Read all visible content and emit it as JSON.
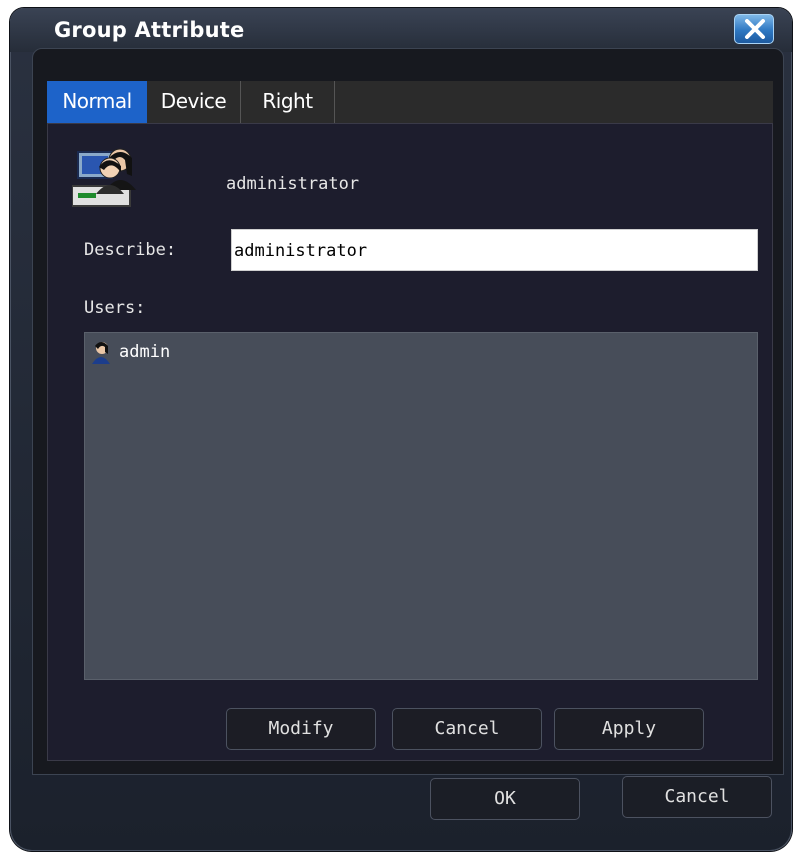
{
  "window": {
    "title": "Group Attribute"
  },
  "tabs": [
    {
      "label": "Normal",
      "active": true
    },
    {
      "label": "Device",
      "active": false
    },
    {
      "label": "Right",
      "active": false
    }
  ],
  "normal_tab": {
    "group_name": "administrator",
    "describe_label": "Describe:",
    "describe_value": "administrator",
    "users_label": "Users:",
    "users": [
      {
        "name": "admin",
        "icon": "user-icon"
      }
    ],
    "buttons": {
      "modify": "Modify",
      "cancel": "Cancel",
      "apply": "Apply"
    }
  },
  "footer": {
    "ok": "OK",
    "cancel": "Cancel"
  },
  "icons": {
    "group": "user-group-icon",
    "close": "close-icon"
  },
  "colors": {
    "active_tab": "#1d63c9",
    "list_background": "#474d59",
    "panel_background": "#1d1d2d"
  }
}
